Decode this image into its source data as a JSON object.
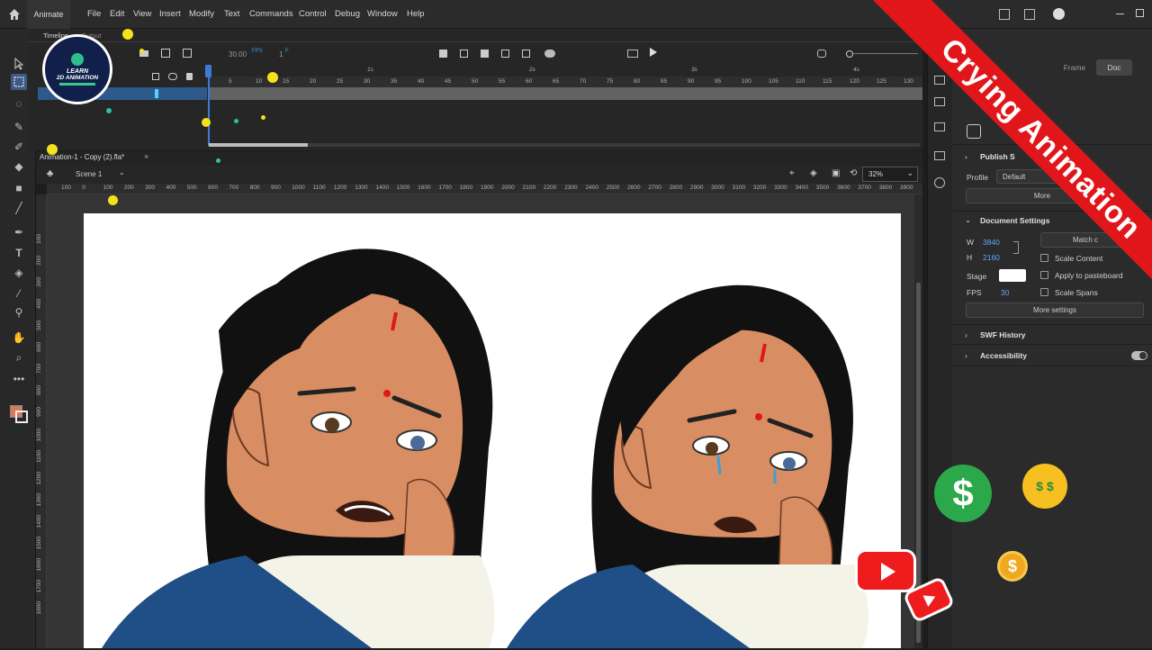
{
  "app": {
    "tab_label": "Animate"
  },
  "menus": [
    "File",
    "Edit",
    "View",
    "Insert",
    "Modify",
    "Text",
    "Commands",
    "Control",
    "Debug",
    "Window",
    "Help"
  ],
  "timeline": {
    "tab_label": "Timeline",
    "tab2_label": "Output",
    "fps_value": "30.00",
    "fps_unit": "FPS",
    "frame_value": "1",
    "frame_unit": "F",
    "seconds": [
      "1s",
      "2s",
      "3s",
      "4s"
    ],
    "frames": [
      "5",
      "10",
      "15",
      "20",
      "25",
      "30",
      "35",
      "40",
      "45",
      "50",
      "55",
      "60",
      "65",
      "70",
      "75",
      "80",
      "85",
      "90",
      "95",
      "100",
      "105",
      "110",
      "115",
      "120",
      "125",
      "130"
    ]
  },
  "document": {
    "tab_label": "Animation-1 - Copy (2).fla*",
    "scene_label": "Scene 1",
    "zoom_value": "32%"
  },
  "ruler_h": [
    "100",
    "0",
    "100",
    "200",
    "300",
    "400",
    "500",
    "600",
    "700",
    "800",
    "900",
    "1000",
    "1100",
    "1200",
    "1300",
    "1400",
    "1500",
    "1600",
    "1700",
    "1800",
    "1900",
    "2000",
    "2100",
    "2200",
    "2300",
    "2400",
    "2500",
    "2600",
    "2700",
    "2800",
    "2900",
    "3000",
    "3100",
    "3200",
    "3300",
    "3400",
    "3500",
    "3600",
    "3700",
    "3800",
    "3900"
  ],
  "ruler_v": [
    "100",
    "200",
    "300",
    "400",
    "500",
    "600",
    "700",
    "800",
    "900",
    "1000",
    "1100",
    "1200",
    "1300",
    "1400",
    "1500",
    "1600",
    "1700",
    "1800"
  ],
  "properties": {
    "tab_frame": "Frame",
    "tab_doc": "Doc",
    "publish_label": "Publish S",
    "profile_label": "Profile",
    "profile_value": "Default",
    "more_btn": "More",
    "doc_settings_label": "Document Settings",
    "w_label": "W",
    "w_value": "3840",
    "h_label": "H",
    "h_value": "2160",
    "match_btn": "Match c",
    "scale_content": "Scale Content",
    "apply_pasteboard": "Apply to pasteboard",
    "scale_spans": "Scale Spans",
    "stage_label": "Stage",
    "fps_label": "FPS",
    "fps_value": "30",
    "more_settings": "More settings",
    "swf_history": "SWF History",
    "accessibility": "Accessibility"
  },
  "logo": {
    "line1": "LEARN",
    "line2": "2D ANIMATION"
  },
  "banner_text": "Crying Animation",
  "colors": {
    "accent": "#e0161b",
    "layer_selected": "#2d5a8a",
    "playhead": "#3b7bd6",
    "dress": "#1f4f86"
  }
}
